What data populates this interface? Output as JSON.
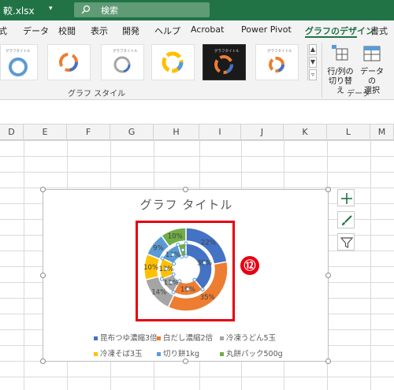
{
  "window": {
    "file_name": "較.xlsx",
    "caret": "▾",
    "search_placeholder": "検索"
  },
  "tabs": [
    {
      "label": "式"
    },
    {
      "label": "データ"
    },
    {
      "label": "校閲"
    },
    {
      "label": "表示"
    },
    {
      "label": "開発"
    },
    {
      "label": "ヘルプ"
    },
    {
      "label": "Acrobat"
    },
    {
      "label": "Power Pivot"
    },
    {
      "label": "グラフのデザイン",
      "active": true
    },
    {
      "label": "書式"
    }
  ],
  "ribbon": {
    "gallery_group_label": "グラフ スタイル",
    "data_group_label": "データ",
    "switch_row_col": [
      "行/列の",
      "切り替え"
    ],
    "select_data": [
      "データの",
      "選択"
    ],
    "style_thumb_title": "グラフタイトル"
  },
  "columns": [
    "D",
    "E",
    "F",
    "G",
    "H",
    "I",
    "J",
    "K",
    "L",
    "M"
  ],
  "chart_data": {
    "type": "pie",
    "subtype": "doughnut",
    "title": "グラフ タイトル",
    "series_labels": [
      "昆布つゆ濃縮3倍",
      "白だし濃縮2倍",
      "冷凍うどん5玉",
      "冷凍そば3玉",
      "切り餅1kg",
      "丸餅パック500g"
    ],
    "outer_ring_percent": [
      22,
      35,
      14,
      10,
      9,
      10
    ],
    "inner_ring_percent": [
      39,
      19,
      11,
      13,
      13,
      5
    ],
    "colors": [
      "#4472c4",
      "#ed7d31",
      "#a5a5a5",
      "#ffc000",
      "#5b9bd5",
      "#70ad47"
    ],
    "outer_data_labels": [
      "22%",
      "35%",
      "14%",
      "10%",
      "9%",
      "10%"
    ],
    "inner_data_labels": [
      "39%",
      "19%",
      "11%",
      "13%",
      "13%",
      ""
    ],
    "legend": "bottom",
    "annotation_badge": "⑫"
  }
}
